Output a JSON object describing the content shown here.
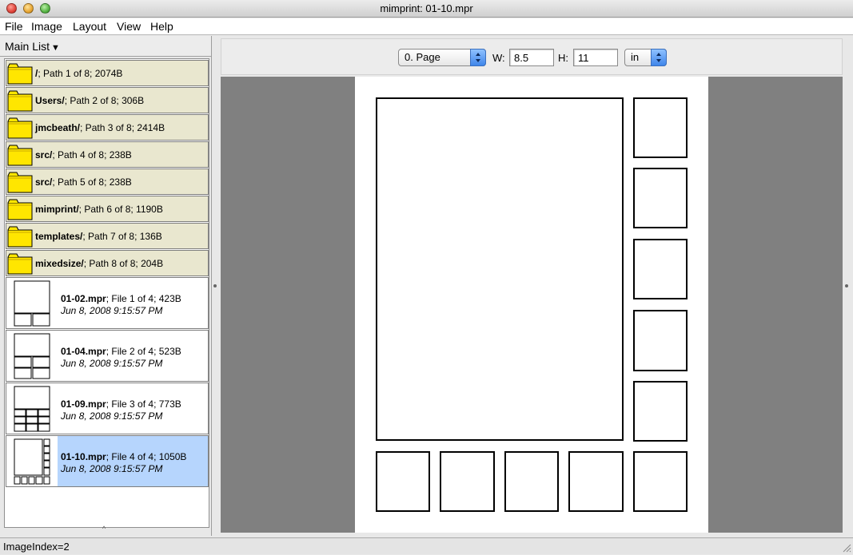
{
  "window": {
    "title": "mimprint: 01-10.mpr"
  },
  "menu": [
    "File",
    "Image",
    "Layout",
    "View",
    "Help"
  ],
  "list": {
    "header": "Main List",
    "dirs": [
      {
        "name": "/",
        "info": "; Path 1 of 8; 2074B"
      },
      {
        "name": "Users/",
        "info": "; Path 2 of 8; 306B"
      },
      {
        "name": "jmcbeath/",
        "info": "; Path 3 of 8; 2414B"
      },
      {
        "name": "src/",
        "info": "; Path 4 of 8; 238B"
      },
      {
        "name": "src/",
        "info": "; Path 5 of 8; 238B"
      },
      {
        "name": "mimprint/",
        "info": "; Path 6 of 8; 1190B"
      },
      {
        "name": "templates/",
        "info": "; Path 7 of 8; 136B"
      },
      {
        "name": "mixedsize/",
        "info": "; Path 8 of 8; 204B"
      }
    ],
    "files": [
      {
        "name": "01-02.mpr",
        "info": "; File 1 of 4; 423B",
        "date": "Jun 8, 2008 9:15:57 PM",
        "selected": false
      },
      {
        "name": "01-04.mpr",
        "info": "; File 2 of 4; 523B",
        "date": "Jun 8, 2008 9:15:57 PM",
        "selected": false
      },
      {
        "name": "01-09.mpr",
        "info": "; File 3 of 4; 773B",
        "date": "Jun 8, 2008 9:15:57 PM",
        "selected": false
      },
      {
        "name": "01-10.mpr",
        "info": "; File 4 of 4; 1050B",
        "date": "Jun 8, 2008 9:15:57 PM",
        "selected": true
      }
    ]
  },
  "toolbar": {
    "page_select": "0. Page",
    "w_label": "W:",
    "w_value": "8.5",
    "h_label": "H:",
    "h_value": "11",
    "unit_select": "in"
  },
  "status": {
    "text": "ImageIndex=2"
  },
  "colors": {
    "dir_row_bg": "#e9e7cf",
    "folder_yellow": "#ffe600",
    "selection": "#b6d5fd",
    "canvas_gray": "#808080"
  }
}
